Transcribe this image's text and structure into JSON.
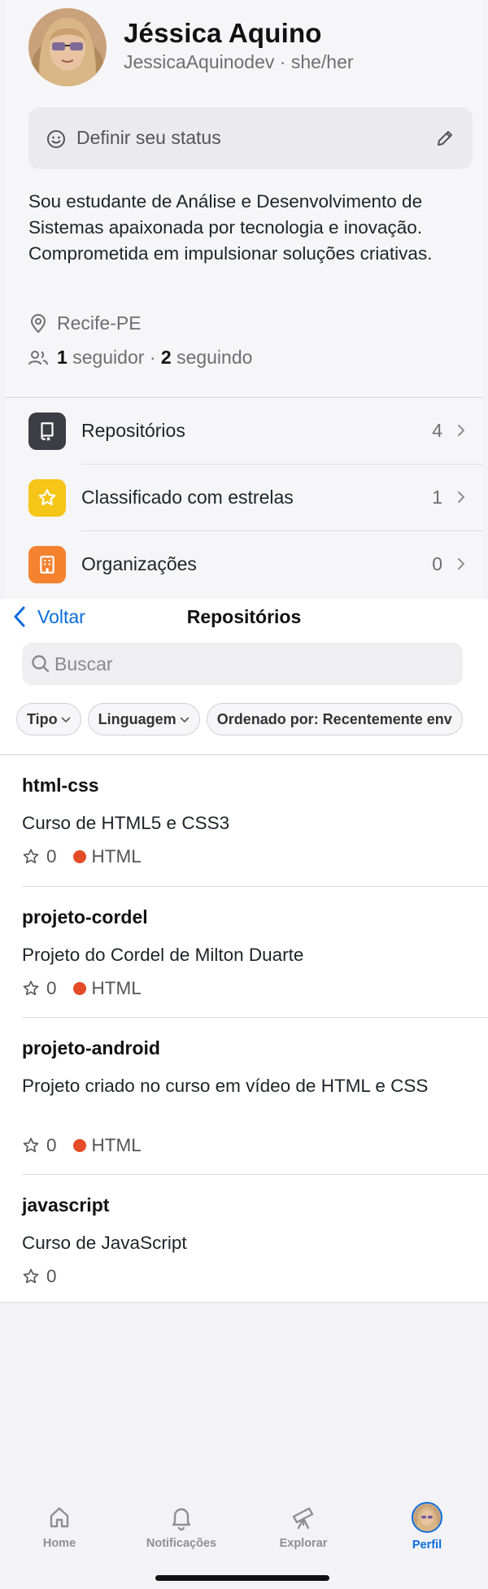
{
  "profile": {
    "name": "Jéssica Aquino",
    "login_line": "JessicaAquinodev · she/her",
    "status_placeholder": "Definir seu status",
    "bio": "Sou estudante de Análise e Desenvolvimento de Sistemas apaixonada por tecnologia e inovação. Comprometida em impulsionar soluções criativas.",
    "location": "Recife-PE",
    "followers_count": "1",
    "followers_label": "seguidor",
    "separator": "·",
    "following_count": "2",
    "following_label": "seguindo"
  },
  "menu": [
    {
      "label": "Repositórios",
      "count": "4",
      "icon": "repo-icon",
      "color": "#3d3d45"
    },
    {
      "label": "Classificado com estrelas",
      "count": "1",
      "icon": "star-icon",
      "color": "#f5c518"
    },
    {
      "label": "Organizações",
      "count": "0",
      "icon": "building-icon",
      "color": "#f4822f"
    }
  ],
  "repos_screen": {
    "back_label": "Voltar",
    "title": "Repositórios",
    "search_placeholder": "Buscar",
    "filters": [
      "Tipo",
      "Linguagem",
      "Ordenado por: Recentemente env"
    ],
    "repos": [
      {
        "name": "html-css",
        "description": "Curso de HTML5 e CSS3",
        "stars": "0",
        "language": "HTML"
      },
      {
        "name": "projeto-cordel",
        "description": "Projeto do Cordel de Milton Duarte",
        "stars": "0",
        "language": "HTML"
      },
      {
        "name": "projeto-android",
        "description": "Projeto criado no curso em vídeo de HTML e CSS",
        "stars": "0",
        "language": "HTML"
      },
      {
        "name": "javascript",
        "description": "Curso de JavaScript",
        "stars": "0",
        "language": ""
      }
    ],
    "language_color": "#e34c26"
  },
  "tabbar": {
    "tabs": [
      {
        "label": "Home",
        "icon": "home-icon"
      },
      {
        "label": "Notificações",
        "icon": "bell-icon"
      },
      {
        "label": "Explorar",
        "icon": "telescope-icon"
      },
      {
        "label": "Perfil",
        "icon": "avatar-icon",
        "active": true
      }
    ],
    "accent": "#0a6cdc"
  }
}
